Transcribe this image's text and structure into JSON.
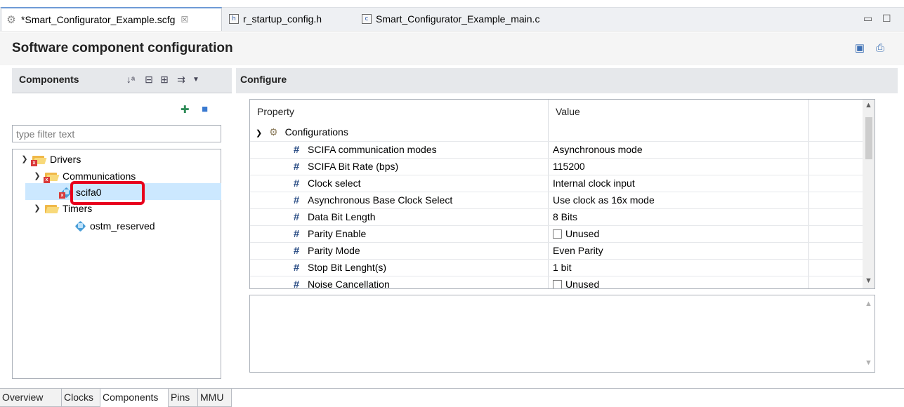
{
  "tabs": [
    {
      "label": "*Smart_Configurator_Example.scfg",
      "icon": "gear-icon",
      "close": "☒"
    },
    {
      "label": "r_startup_config.h",
      "icon": "h-file-icon",
      "badge": "h"
    },
    {
      "label": "Smart_Configurator_Example_main.c",
      "icon": "c-file-icon",
      "badge": "c"
    }
  ],
  "window": {
    "minimize": "▭",
    "maximize": "☐"
  },
  "header": {
    "title": "Software component configuration"
  },
  "components": {
    "title": "Components",
    "filter_placeholder": "type filter text",
    "tree": {
      "drivers": "Drivers",
      "communications": "Communications",
      "scifa0": "scifa0",
      "timers": "Timers",
      "ostm_reserved": "ostm_reserved"
    }
  },
  "configure": {
    "title": "Configure",
    "columns": {
      "property": "Property",
      "value": "Value"
    },
    "group": "Configurations",
    "rows": [
      {
        "property": "SCIFA communication modes",
        "value": "Asynchronous mode",
        "checkbox": false
      },
      {
        "property": "SCIFA Bit Rate (bps)",
        "value": "115200",
        "checkbox": false
      },
      {
        "property": "Clock select",
        "value": "Internal clock input",
        "checkbox": false
      },
      {
        "property": "Asynchronous Base Clock Select",
        "value": "Use clock as 16x mode",
        "checkbox": false
      },
      {
        "property": "Data Bit Length",
        "value": "8 Bits",
        "checkbox": false
      },
      {
        "property": "Parity Enable",
        "value": "Unused",
        "checkbox": true
      },
      {
        "property": "Parity Mode",
        "value": "Even Parity",
        "checkbox": false
      },
      {
        "property": "Stop Bit Lenght(s)",
        "value": "1 bit",
        "checkbox": false
      },
      {
        "property": "Noise Cancellation",
        "value": "Unused",
        "checkbox": true
      }
    ]
  },
  "bottom_tabs": [
    "Overview",
    "Clocks",
    "Components",
    "Pins",
    "MMU"
  ],
  "active_bottom_tab": "Components",
  "colors": {
    "accent": "#6e9bd6",
    "selection": "#cce8ff",
    "highlight": "#e8001c"
  }
}
